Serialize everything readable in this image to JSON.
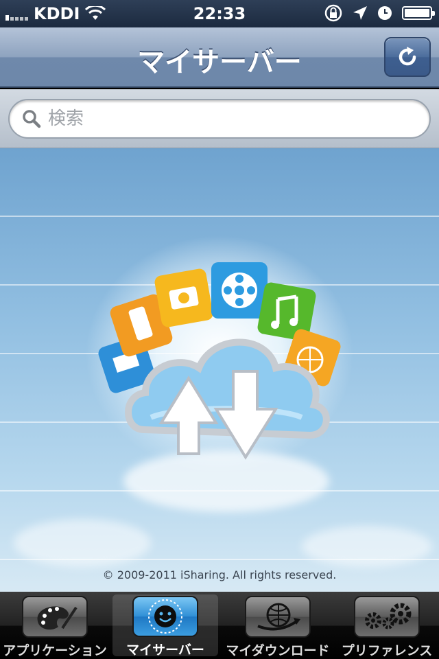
{
  "status_bar": {
    "carrier": "KDDI",
    "time": "22:33",
    "icons": [
      "signal-icon",
      "wifi-icon",
      "rotation-lock-icon",
      "location-icon",
      "alarm-icon",
      "battery-icon"
    ]
  },
  "navbar": {
    "title": "マイサーバー",
    "refresh_icon": "refresh-icon"
  },
  "search": {
    "placeholder": "検索",
    "value": ""
  },
  "content": {
    "copyright": "© 2009-2011 iSharing. All rights reserved."
  },
  "tabs": [
    {
      "label": "アプリケーション",
      "icon": "palette-icon",
      "active": false
    },
    {
      "label": "マイサーバー",
      "icon": "smiley-network-icon",
      "active": true
    },
    {
      "label": "マイダウンロード",
      "icon": "globe-download-icon",
      "active": false
    },
    {
      "label": "プリファレンス",
      "icon": "gears-icon",
      "active": false
    }
  ],
  "colors": {
    "navbar": "#7f97b8",
    "active_tab": "#2f8fd6",
    "sky": "#93c0e2"
  }
}
